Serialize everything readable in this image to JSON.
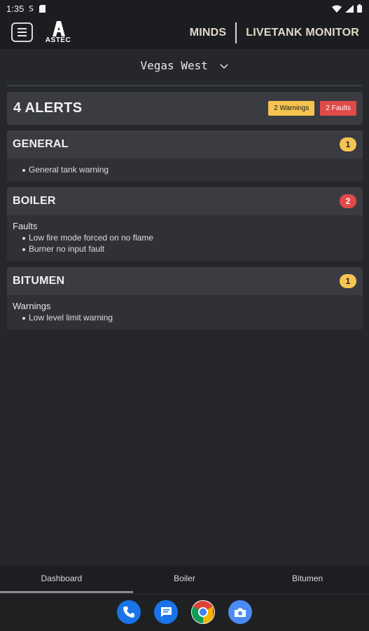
{
  "status_bar": {
    "time": "1:35",
    "icons": [
      "circle-s-icon",
      "sd-card-icon",
      "wifi-icon",
      "signal-icon",
      "battery-icon"
    ]
  },
  "header": {
    "logo_text": "ASTEC",
    "brand": "MINDS",
    "product": "LIVETANK MONITOR"
  },
  "location": {
    "selected": "Vegas West"
  },
  "alerts": {
    "title": "4 ALERTS",
    "warnings_badge": "2 Warnings",
    "faults_badge": "2 Faults"
  },
  "sections": [
    {
      "title": "GENERAL",
      "count": "1",
      "items": [
        "General tank warning"
      ]
    },
    {
      "title": "BOILER",
      "count": "2",
      "group": "Faults",
      "items": [
        "Low fire mode forced on no flame",
        "Burner no input fault"
      ]
    },
    {
      "title": "BITUMEN",
      "count": "1",
      "group": "Warnings",
      "items": [
        "Low level limit warning"
      ]
    }
  ],
  "tabs": [
    {
      "label": "Dashboard"
    },
    {
      "label": "Boiler"
    },
    {
      "label": "Bitumen"
    }
  ],
  "dock": [
    "phone-icon",
    "messages-icon",
    "chrome-icon",
    "camera-icon"
  ],
  "colors": {
    "warning": "#f5c451",
    "fault": "#e24a4a",
    "background": "#26272b",
    "card": "#3a3c42"
  }
}
